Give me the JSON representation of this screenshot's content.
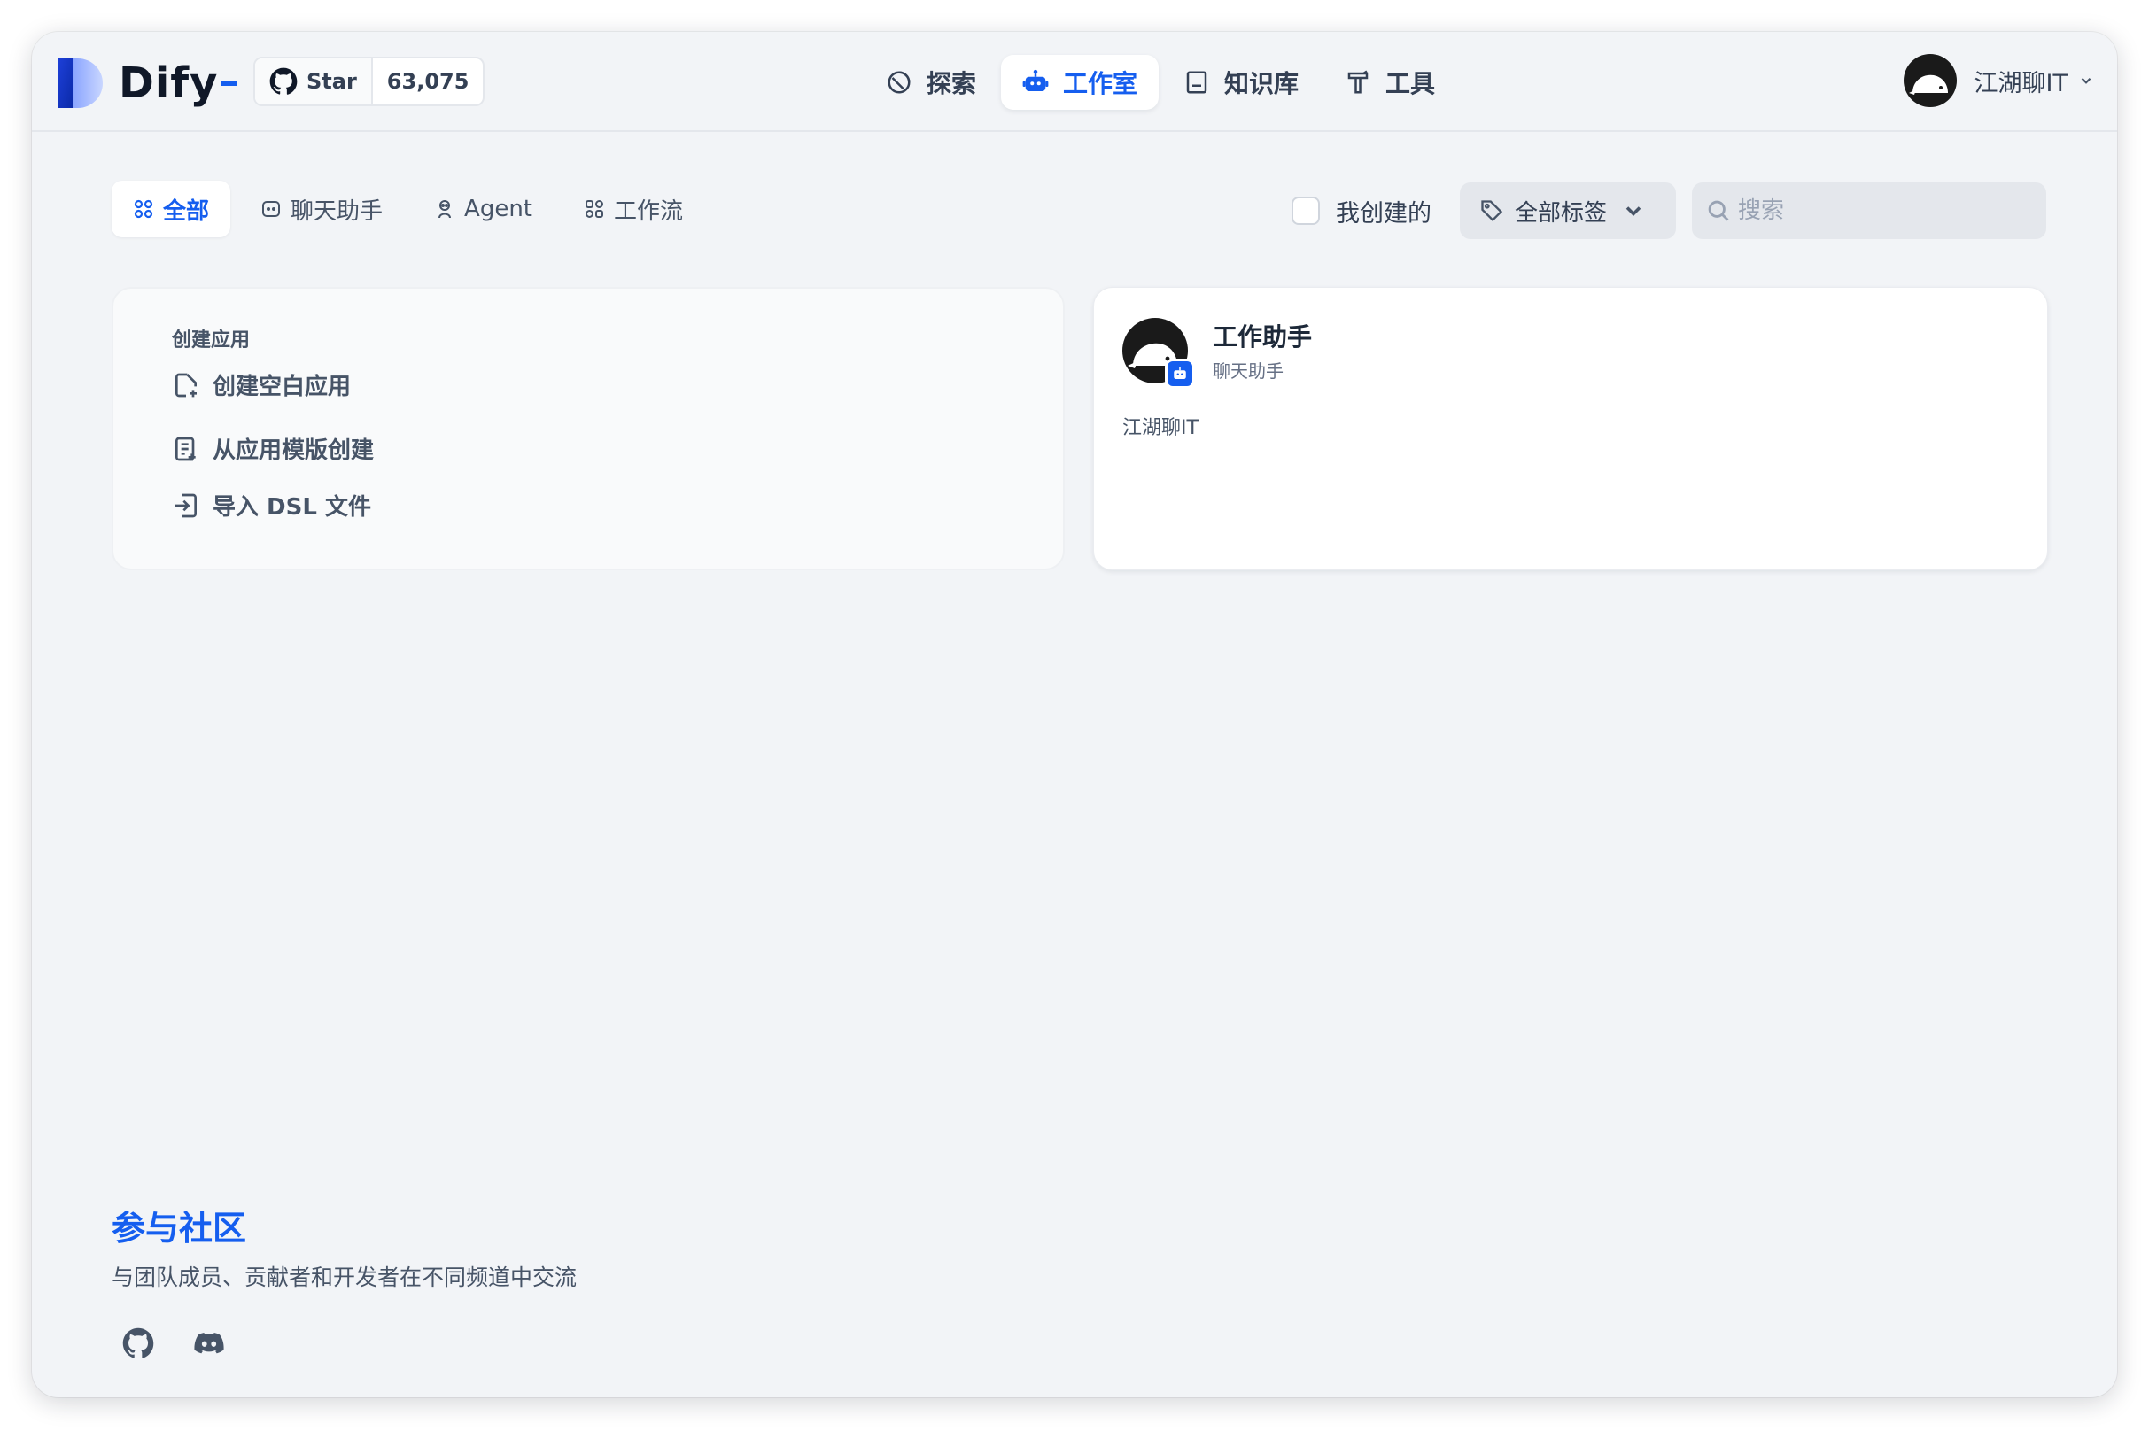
{
  "brand": {
    "name": "Dify",
    "accent": "#155eef"
  },
  "github": {
    "star_label": "Star",
    "star_count": "63,075"
  },
  "nav": {
    "items": [
      {
        "label": "探索",
        "icon": "compass-icon"
      },
      {
        "label": "工作室",
        "icon": "robot-icon",
        "active": true
      },
      {
        "label": "知识库",
        "icon": "book-icon"
      },
      {
        "label": "工具",
        "icon": "hammer-icon"
      }
    ]
  },
  "user": {
    "name": "江湖聊IT"
  },
  "tabs": [
    {
      "label": "全部",
      "icon": "grid-icon",
      "active": true
    },
    {
      "label": "聊天助手",
      "icon": "chat-bubble-icon"
    },
    {
      "label": "Agent",
      "icon": "agent-icon"
    },
    {
      "label": "工作流",
      "icon": "workflow-icon"
    }
  ],
  "filters": {
    "mine_label": "我创建的",
    "tag_select_label": "全部标签",
    "search_placeholder": "搜索"
  },
  "create": {
    "title": "创建应用",
    "items": [
      {
        "label": "创建空白应用",
        "icon": "new-file-icon"
      },
      {
        "label": "从应用模版创建",
        "icon": "template-icon"
      },
      {
        "label": "导入 DSL 文件",
        "icon": "import-icon"
      }
    ]
  },
  "apps": [
    {
      "name": "工作助手",
      "type": "聊天助手",
      "description": "江湖聊IT"
    }
  ],
  "community": {
    "title": "参与社区",
    "subtitle": "与团队成员、贡献者和开发者在不同频道中交流"
  }
}
